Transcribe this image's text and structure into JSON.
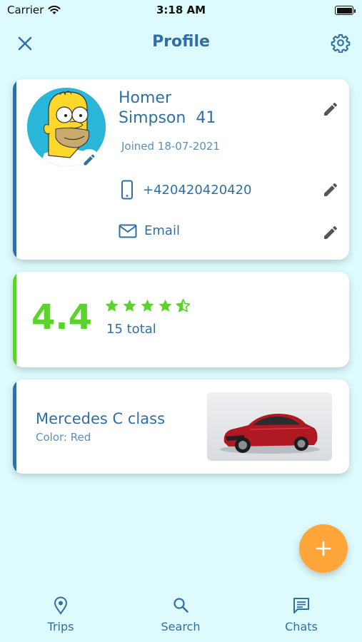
{
  "status_bar": {
    "carrier": "Carrier",
    "time": "3:18 AM"
  },
  "header": {
    "title": "Profile",
    "close_icon": "close-icon",
    "settings_icon": "gear-icon"
  },
  "profile": {
    "first_name": "Homer",
    "last_name": "Simpson",
    "age": "41",
    "joined": "Joined 18-07-2021",
    "phone": "+420420420420",
    "email": "Email"
  },
  "rating": {
    "value": "4.4",
    "stars": 4.5,
    "total": "15 total"
  },
  "car": {
    "name": "Mercedes C class",
    "color": "Color: Red"
  },
  "bottom_nav": {
    "items": [
      {
        "label": "Trips",
        "icon": "location-pin-icon"
      },
      {
        "label": "Search",
        "icon": "search-icon"
      },
      {
        "label": "Chats",
        "icon": "chat-icon"
      }
    ]
  },
  "colors": {
    "primary": "#2f6fa3",
    "rating": "#5ad42a",
    "fab": "#ffa63a",
    "background": "#ddfbfd"
  }
}
